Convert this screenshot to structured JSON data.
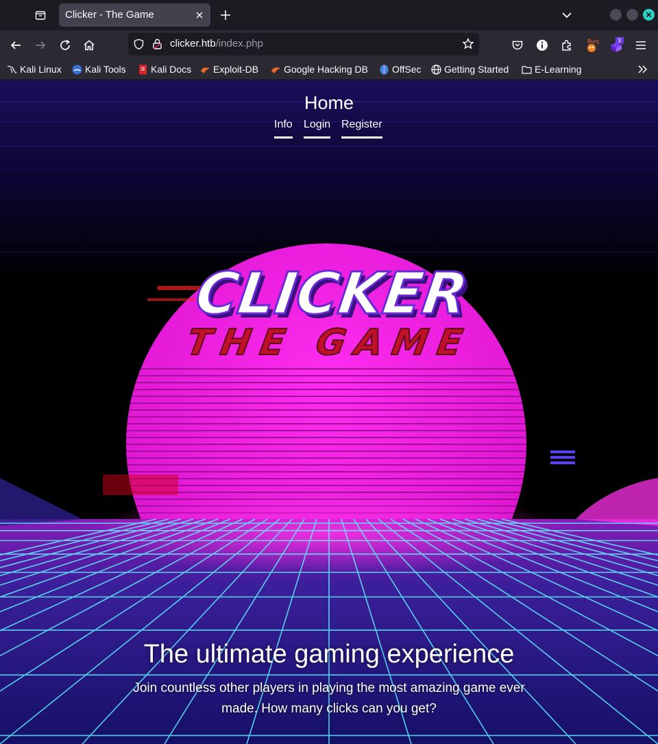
{
  "browser": {
    "tab_title": "Clicker - The Game",
    "url_host": "clicker.htb",
    "url_path": "/index.php",
    "extension_badge": "3",
    "burp_label": "Burp",
    "bookmarks": [
      {
        "label": "Kali Linux",
        "icon": "kali-dragon-icon"
      },
      {
        "label": "Kali Tools",
        "icon": "kali-tools-icon"
      },
      {
        "label": "Kali Docs",
        "icon": "kali-docs-icon"
      },
      {
        "label": "Exploit-DB",
        "icon": "exploitdb-icon"
      },
      {
        "label": "Google Hacking DB",
        "icon": "ghdb-icon"
      },
      {
        "label": "OffSec",
        "icon": "offsec-icon"
      },
      {
        "label": "Getting Started",
        "icon": "globe-icon"
      },
      {
        "label": "E-Learning",
        "icon": "folder-icon"
      }
    ]
  },
  "page": {
    "title": "Home",
    "nav": [
      "Info",
      "Login",
      "Register"
    ],
    "logo_line1": "CLICKER",
    "logo_line2": "THE GAME",
    "hero_heading": "The ultimate gaming experience",
    "hero_subtext": "Join countless other players in playing the most amazing game ever made. How many clicks can you get?"
  },
  "colors": {
    "sun": "#f015e0",
    "grid": "#5ef2ff",
    "logo_red": "#c0102a",
    "sky": "#150a45"
  }
}
